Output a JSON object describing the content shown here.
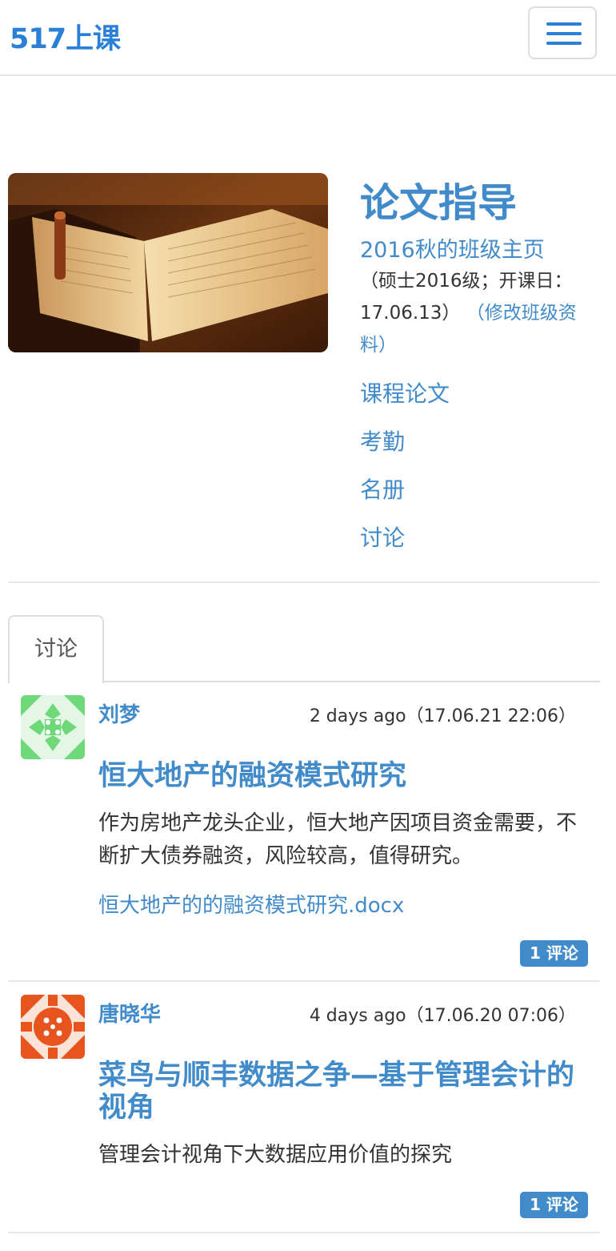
{
  "navbar": {
    "brand": "517上课",
    "menu_icon": "hamburger-menu-icon"
  },
  "course": {
    "title": "论文指导",
    "class_home_link": "2016秋的班级主页",
    "class_info_prefix": "（硕士2016级；开课日：17.06.13）",
    "edit_link": "（修改班级资料）",
    "links": [
      "课程论文",
      "考勤",
      "名册",
      "讨论"
    ]
  },
  "tabs": {
    "active": "讨论"
  },
  "posts": [
    {
      "author": "刘梦",
      "time": "2 days ago（17.06.21 22:06）",
      "title": "恒大地产的融资模式研究",
      "description": "作为房地产龙头企业，恒大地产因项目资金需要，不断扩大债券融资，风险较高，值得研究。",
      "attachment": "恒大地产的的融资模式研究.docx",
      "comments": "1 评论",
      "avatar_color": "#6fd97a"
    },
    {
      "author": "唐晓华",
      "time": "4 days ago（17.06.20 07:06）",
      "title": "菜鸟与顺丰数据之争—基于管理会计的视角",
      "description": "管理会计视角下大数据应用价值的探究",
      "comments": "1 评论",
      "avatar_color": "#e8541e"
    }
  ],
  "colors": {
    "link": "#428bca",
    "brand": "#2a7fd6"
  }
}
